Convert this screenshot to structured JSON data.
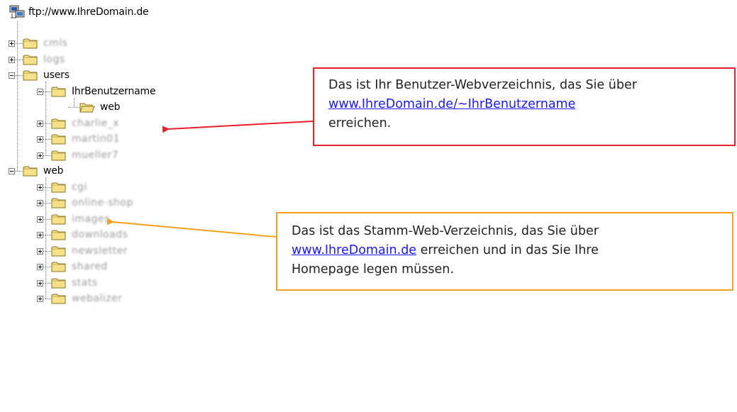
{
  "tree": {
    "root_label": "ftp://www.IhreDomain.de",
    "items": [
      {
        "label": "cmls",
        "level": 1,
        "expander": "plus",
        "blurred": true
      },
      {
        "label": "logs",
        "level": 1,
        "expander": "plus",
        "blurred": true
      },
      {
        "label": "users",
        "level": 1,
        "expander": "minus",
        "blurred": false
      },
      {
        "label": "IhrBenutzername",
        "level": 2,
        "expander": "minus",
        "blurred": false
      },
      {
        "label": "web",
        "level": 3,
        "expander": "none",
        "blurred": false,
        "open": true
      },
      {
        "label": "charlie_x",
        "level": 2,
        "expander": "plus",
        "blurred": true
      },
      {
        "label": "martin01",
        "level": 2,
        "expander": "plus",
        "blurred": true
      },
      {
        "label": "mueller7",
        "level": 2,
        "expander": "plus",
        "blurred": true
      },
      {
        "label": "web",
        "level": 1,
        "expander": "minus",
        "blurred": false
      },
      {
        "label": "cgi",
        "level": 2,
        "expander": "plus",
        "blurred": true
      },
      {
        "label": "online-shop",
        "level": 2,
        "expander": "plus",
        "blurred": true
      },
      {
        "label": "images",
        "level": 2,
        "expander": "plus",
        "blurred": true
      },
      {
        "label": "downloads",
        "level": 2,
        "expander": "plus",
        "blurred": true
      },
      {
        "label": "newsletter",
        "level": 2,
        "expander": "plus",
        "blurred": true
      },
      {
        "label": "shared",
        "level": 2,
        "expander": "plus",
        "blurred": true
      },
      {
        "label": "stats",
        "level": 2,
        "expander": "plus",
        "blurred": true
      },
      {
        "label": "webalizer",
        "level": 2,
        "expander": "plus",
        "blurred": true
      }
    ]
  },
  "callouts": {
    "user_dir": {
      "line1": "Das ist Ihr Benutzer-Webverzeichnis, das Sie über",
      "link": "www.IhreDomain.de/~IhrBenutzername",
      "line3": "erreichen.",
      "border_color": "#e8202a"
    },
    "root_dir": {
      "line1": "Das ist das Stamm-Web-Verzeichnis, das Sie über",
      "link": "www.IhreDomain.de",
      "line2_rest": " erreichen und in das Sie Ihre",
      "line3": "Homepage legen müssen.",
      "border_color": "#f5a11f"
    }
  },
  "colors": {
    "folder_fill": "#f6e08a",
    "folder_stroke": "#8a7420",
    "link": "#1a1aee",
    "arrow_red": "#e8202a",
    "arrow_orange": "#f5a11f"
  }
}
